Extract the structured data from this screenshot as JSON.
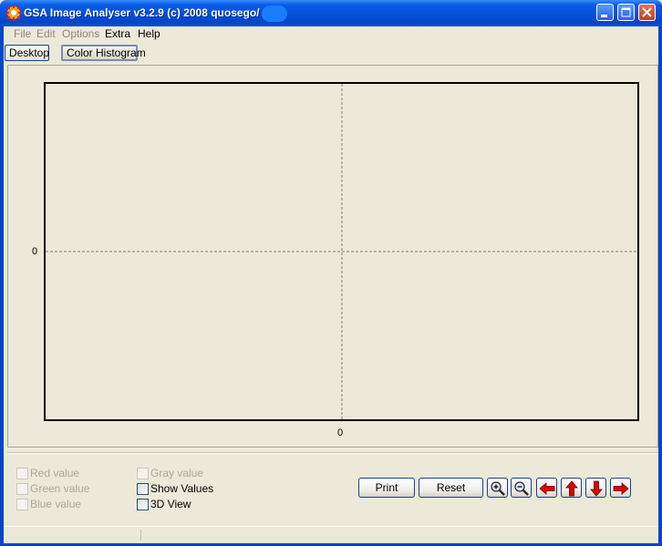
{
  "window": {
    "title": "GSA Image Analyser v3.2.9 (c) 2008  quosego/",
    "icons": [
      "app-gear-icon",
      "minimize-icon",
      "maximize-icon",
      "close-icon"
    ]
  },
  "menu": {
    "file": "File",
    "edit": "Edit",
    "options": "Options",
    "extra": "Extra",
    "help": "Help"
  },
  "tabs": {
    "desktop": "Desktop",
    "color_histogram": "Color Histogram"
  },
  "chart_data": {
    "type": "line",
    "series": [],
    "x_tick_labels": [
      "0"
    ],
    "y_tick_labels": [
      "0"
    ],
    "grid": "dashed crosshair at 0",
    "background": "#ece9d8"
  },
  "options": {
    "red_value": "Red value",
    "green_value": "Green value",
    "blue_value": "Blue value",
    "gray_value": "Gray value",
    "show_values": "Show Values",
    "view_3d": "3D View"
  },
  "buttons": {
    "print": "Print",
    "reset": "Reset",
    "icons": [
      "zoom-in-icon",
      "zoom-out-icon",
      "arrow-left-icon",
      "arrow-up-icon",
      "arrow-down-icon",
      "arrow-right-icon"
    ]
  },
  "colors": {
    "titlebar": "#0450d8",
    "arrow": "#e00000",
    "panel": "#ece9d8"
  }
}
